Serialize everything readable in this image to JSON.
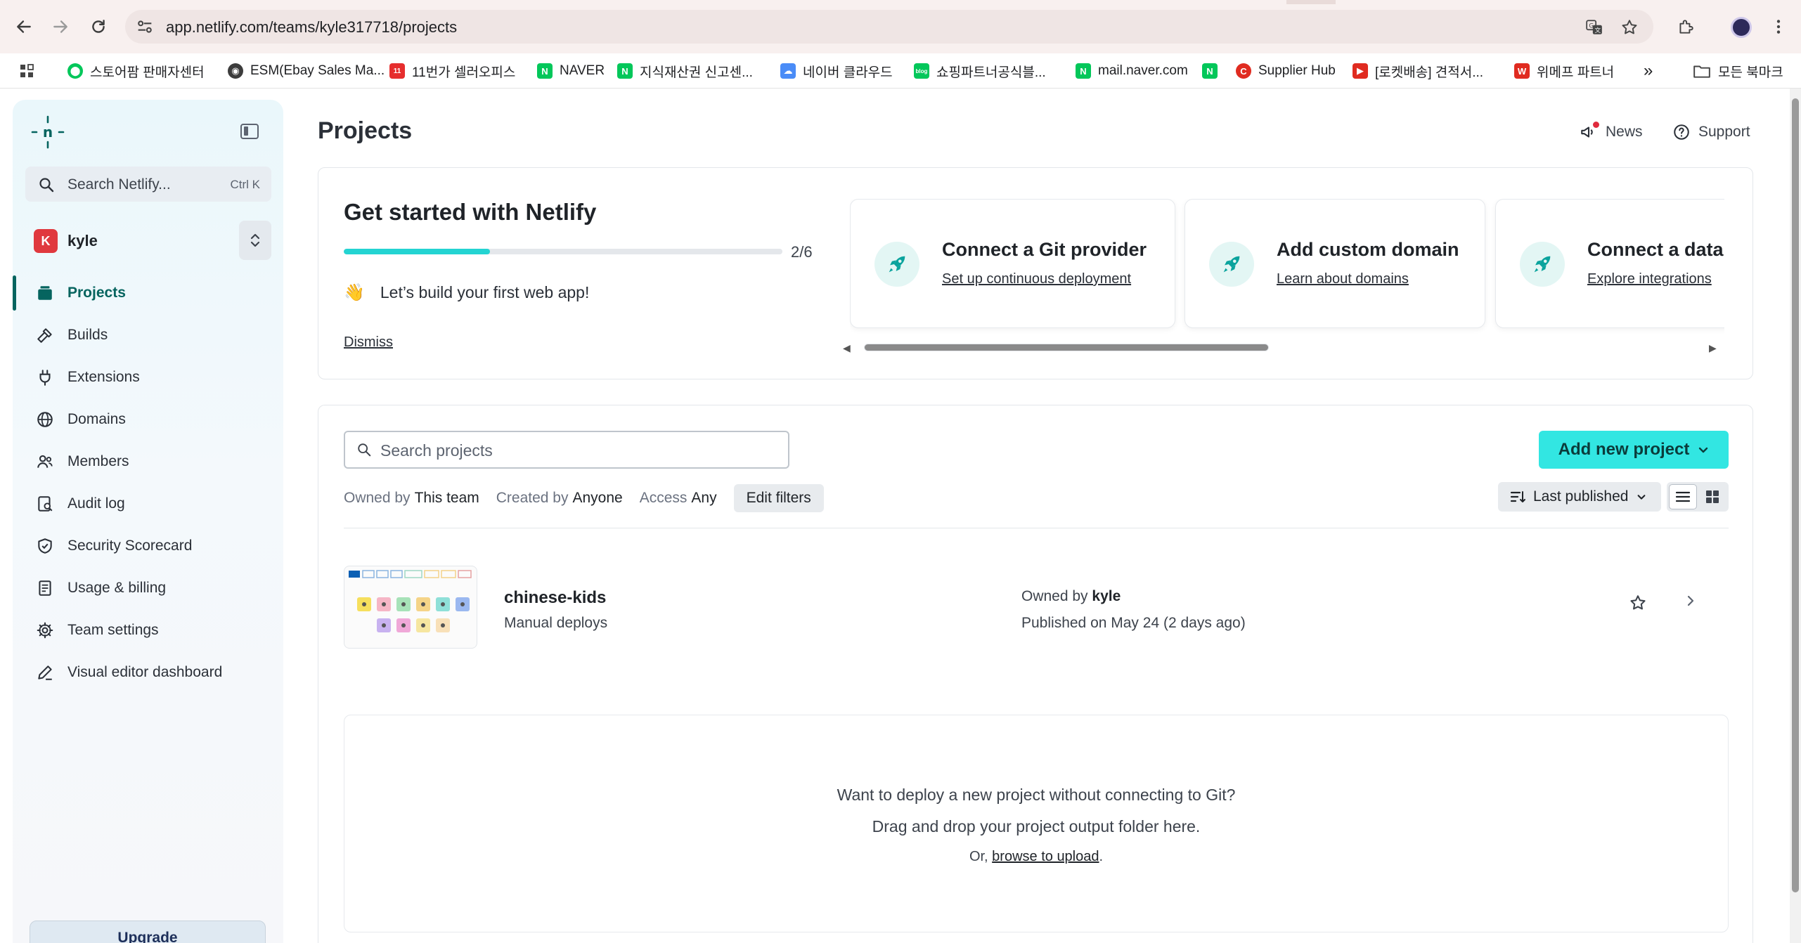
{
  "browser": {
    "url_host": "app.netlify.com",
    "url_path": "/teams/kyle317718/projects",
    "bookmarks": [
      {
        "label": "스토어팜 판매자센터",
        "color": "#03c75a",
        "icon": "smartstore-icon"
      },
      {
        "label": "ESM(Ebay Sales Ma...",
        "color": "#3c3c3c",
        "icon": "globe-icon"
      },
      {
        "label": "11번가 셀러오피스",
        "color": "#e62e2e",
        "icon": "11st-icon"
      },
      {
        "label": "NAVER",
        "color": "#03c75a",
        "icon": "naver-icon"
      },
      {
        "label": "지식재산권 신고센...",
        "color": "#03c75a",
        "icon": "naver-icon"
      },
      {
        "label": "네이버 클라우드",
        "color": "#4a8cf7",
        "icon": "cloud-icon"
      },
      {
        "label": "쇼핑파트너공식블...",
        "color": "#03c75a",
        "icon": "blog-icon"
      },
      {
        "label": "mail.naver.com",
        "color": "#03c75a",
        "icon": "naver-icon"
      },
      {
        "label": "",
        "color": "#03c75a",
        "icon": "naver-icon"
      },
      {
        "label": "Supplier Hub",
        "color": "#e02b20",
        "icon": "coupang-icon"
      },
      {
        "label": "[로켓배송] 견적서...",
        "color": "#e02b20",
        "icon": "youtube-icon"
      },
      {
        "label": "위메프 파트너",
        "color": "#e02b20",
        "icon": "wemakeprice-icon"
      }
    ],
    "more_label": "»",
    "all_bookmarks": "모든 북마크"
  },
  "sidebar": {
    "search_label": "Search Netlify...",
    "search_shortcut": "Ctrl K",
    "team_initial": "K",
    "team_name": "kyle",
    "items": [
      {
        "label": "Projects",
        "icon": "projects-icon",
        "active": true
      },
      {
        "label": "Builds",
        "icon": "hammer-icon"
      },
      {
        "label": "Extensions",
        "icon": "plug-icon"
      },
      {
        "label": "Domains",
        "icon": "globe-icon"
      },
      {
        "label": "Members",
        "icon": "members-icon"
      },
      {
        "label": "Audit log",
        "icon": "audit-log-icon"
      },
      {
        "label": "Security Scorecard",
        "icon": "shield-icon"
      },
      {
        "label": "Usage & billing",
        "icon": "receipt-icon"
      },
      {
        "label": "Team settings",
        "icon": "gear-icon"
      },
      {
        "label": "Visual editor dashboard",
        "icon": "pencil-icon"
      }
    ],
    "upgrade_label": "Upgrade"
  },
  "header": {
    "title": "Projects",
    "news_label": "News",
    "support_label": "Support"
  },
  "get_started": {
    "title": "Get started with Netlify",
    "progress_done": 2,
    "progress_total": 6,
    "progress_text": "2/6",
    "message": "Let’s build your first web app!",
    "dismiss": "Dismiss",
    "steps": [
      {
        "title": "Connect a Git provider",
        "link": "Set up continuous deployment"
      },
      {
        "title": "Add custom domain",
        "link": "Learn about domains"
      },
      {
        "title": "Connect a data",
        "link": "Explore integrations"
      }
    ]
  },
  "projects": {
    "search_placeholder": "Search projects",
    "add_button": "Add new project",
    "filters": {
      "owned_by_label": "Owned by",
      "owned_by_value": "This team",
      "created_by_label": "Created by",
      "created_by_value": "Anyone",
      "access_label": "Access",
      "access_value": "Any",
      "edit_label": "Edit filters"
    },
    "sort_label": "Last published",
    "list": [
      {
        "name": "chinese-kids",
        "subtitle": "Manual deploys",
        "owner_label": "Owned by",
        "owner": "kyle",
        "published": "Published on May 24 (2 days ago)"
      }
    ],
    "dropzone": {
      "line1": "Want to deploy a new project without connecting to Git?",
      "line2": "Drag and drop your project output folder here.",
      "or_prefix": "Or,",
      "browse_link": "browse to upload",
      "or_suffix": "."
    }
  },
  "colors": {
    "accent_teal": "#32e6e2",
    "progress_fill": "#24d4d2",
    "active_nav": "#05645f",
    "avatar_red": "#e0393e"
  }
}
